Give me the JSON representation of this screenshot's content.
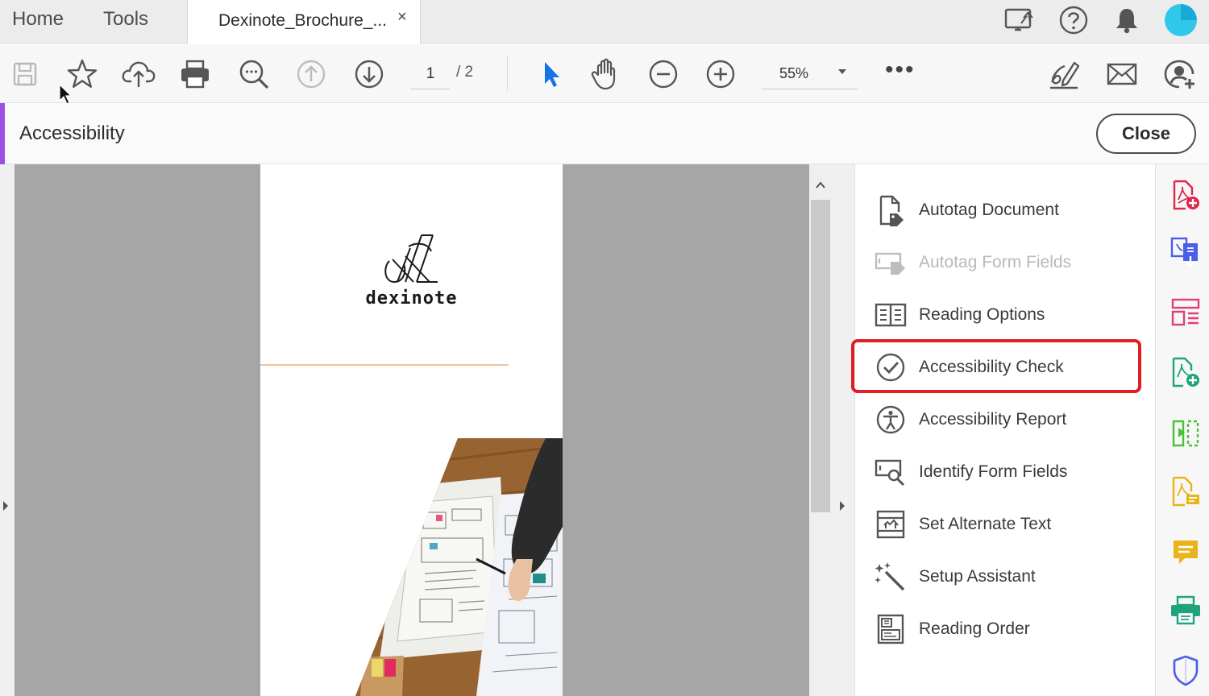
{
  "menubar": {
    "home": "Home",
    "tools": "Tools",
    "tab_label": "Dexinote_Brochure_...",
    "tab_close": "×",
    "icons": [
      "share-screen-icon",
      "help-icon",
      "bell-icon",
      "avatar"
    ]
  },
  "toolbar": {
    "page_current": "1",
    "page_total": "/ 2",
    "zoom": "55%",
    "more": "•••"
  },
  "tool_header": {
    "title": "Accessibility",
    "close": "Close"
  },
  "document": {
    "brand_name": "dexinote"
  },
  "tool_panel": {
    "items": [
      {
        "label": "Autotag Document",
        "icon": "autotag-document-icon",
        "enabled": true
      },
      {
        "label": "Autotag Form Fields",
        "icon": "autotag-form-fields-icon",
        "enabled": false
      },
      {
        "label": "Reading Options",
        "icon": "reading-options-icon",
        "enabled": true
      },
      {
        "label": "Accessibility Check",
        "icon": "accessibility-check-icon",
        "enabled": true,
        "highlighted": true
      },
      {
        "label": "Accessibility Report",
        "icon": "accessibility-report-icon",
        "enabled": true
      },
      {
        "label": "Identify Form Fields",
        "icon": "identify-form-fields-icon",
        "enabled": true
      },
      {
        "label": "Set Alternate Text",
        "icon": "set-alternate-text-icon",
        "enabled": true
      },
      {
        "label": "Setup Assistant",
        "icon": "setup-assistant-icon",
        "enabled": true
      },
      {
        "label": "Reading Order",
        "icon": "reading-order-icon",
        "enabled": true
      }
    ]
  },
  "colors": {
    "accent_purple": "#9b52e3",
    "highlight_red": "#e01e24",
    "rail_red": "#e0274a",
    "rail_blue": "#4a5ee8",
    "rail_pink": "#e23d7a",
    "rail_teal": "#1fa37a",
    "rail_green": "#4cbf3a",
    "rail_yellow": "#e9b31a",
    "rail_shield": "#4a5ee8"
  }
}
